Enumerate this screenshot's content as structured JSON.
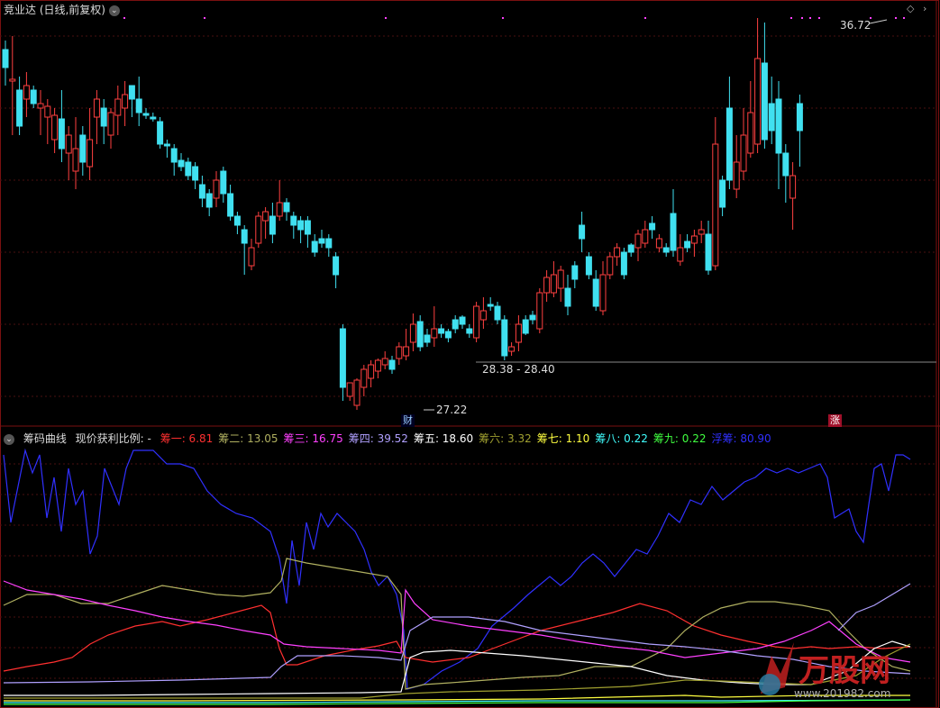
{
  "main": {
    "title": "竞业达 (日线,前复权)",
    "collapse_icon": "chevron-down-icon",
    "high_label": "36.72",
    "low_label": "27.22",
    "range_label": "28.38 - 28.40",
    "badge_left": "财",
    "badge_right": "涨",
    "nav_left_icon": "diamond-icon",
    "nav_right_icon": "chevron-right-icon"
  },
  "indicator": {
    "name": "筹码曲线",
    "ratio_label": "现价获利比例: -",
    "items": [
      {
        "label": "筹一:",
        "value": "6.81",
        "color": "#ff3030"
      },
      {
        "label": "筹二:",
        "value": "13.05",
        "color": "#b0b060"
      },
      {
        "label": "筹三:",
        "value": "16.75",
        "color": "#ff40ff"
      },
      {
        "label": "筹四:",
        "value": "39.52",
        "color": "#b0a0ff"
      },
      {
        "label": "筹五:",
        "value": "18.60",
        "color": "#ffffff"
      },
      {
        "label": "筹六:",
        "value": "3.32",
        "color": "#a0a030"
      },
      {
        "label": "筹七:",
        "value": "1.10",
        "color": "#ffff40"
      },
      {
        "label": "筹八:",
        "value": "0.22",
        "color": "#40ffff"
      },
      {
        "label": "筹九:",
        "value": "0.22",
        "color": "#40ff40"
      },
      {
        "label": "浮筹:",
        "value": "80.90",
        "color": "#3030ff"
      }
    ]
  },
  "chart_data": [
    {
      "type": "candlestick",
      "title": "竞业达 (日线,前复权)",
      "annotations": [
        "36.72",
        "27.22",
        "28.38 - 28.40"
      ],
      "ohlc_shape": "falling trend from ~36 to low 27.22, then recovery up to high 36.72"
    },
    {
      "type": "line",
      "title": "筹码曲线",
      "series": [
        {
          "name": "筹一",
          "color": "#ff3030"
        },
        {
          "name": "筹二",
          "color": "#b0b060"
        },
        {
          "name": "筹三",
          "color": "#ff40ff"
        },
        {
          "name": "筹四",
          "color": "#b0a0ff"
        },
        {
          "name": "筹五",
          "color": "#ffffff"
        },
        {
          "name": "筹六",
          "color": "#a0a030"
        },
        {
          "name": "筹七",
          "color": "#ffff40"
        },
        {
          "name": "筹八",
          "color": "#40ffff"
        },
        {
          "name": "筹九",
          "color": "#40ff40"
        },
        {
          "name": "浮筹",
          "color": "#3030ff"
        }
      ]
    }
  ],
  "watermark": {
    "brand": "万股网",
    "url": "www.201982.com"
  }
}
